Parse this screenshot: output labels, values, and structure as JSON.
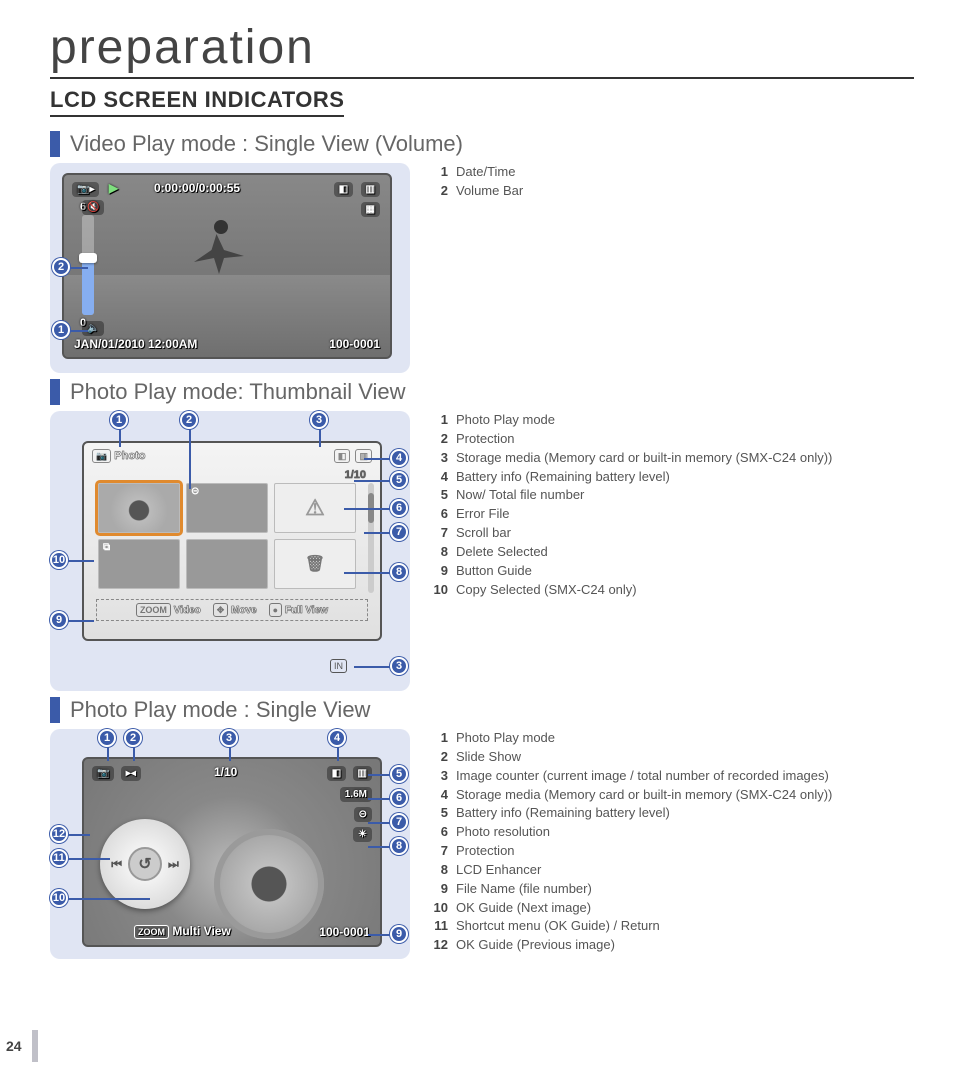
{
  "page_number": "24",
  "chapter": "preparation",
  "section": "LCD SCREEN INDICATORS",
  "subsections": {
    "s1": {
      "title": "Video Play mode : Single View (Volume)"
    },
    "s2": {
      "title": "Photo Play mode: Thumbnail View"
    },
    "s3": {
      "title": "Photo Play mode : Single View"
    }
  },
  "lcd1": {
    "time": "0:00:00/0:00:55",
    "vol_top": "6",
    "vol_bottom": "0",
    "date": "JAN/01/2010 12:00AM",
    "file_no": "100-0001"
  },
  "lcd2": {
    "mode_label": "Photo",
    "counter": "1/10",
    "guide_zoom": "Video",
    "guide_move": "Move",
    "guide_full": "Full View",
    "in_badge": "IN"
  },
  "lcd3": {
    "counter": "1/10",
    "res": "1.6M",
    "multi": "Multi View",
    "file_no": "100-0001"
  },
  "legend1": [
    {
      "n": "1",
      "t": "Date/Time"
    },
    {
      "n": "2",
      "t": "Volume Bar"
    }
  ],
  "legend2": [
    {
      "n": "1",
      "t": "Photo Play mode"
    },
    {
      "n": "2",
      "t": "Protection"
    },
    {
      "n": "3",
      "t": "Storage media (Memory card or built-in memory (SMX-C24 only))"
    },
    {
      "n": "4",
      "t": "Battery info (Remaining battery level)"
    },
    {
      "n": "5",
      "t": "Now/ Total file number"
    },
    {
      "n": "6",
      "t": "Error File"
    },
    {
      "n": "7",
      "t": "Scroll bar"
    },
    {
      "n": "8",
      "t": "Delete Selected"
    },
    {
      "n": "9",
      "t": "Button Guide"
    },
    {
      "n": "10",
      "t": "Copy Selected (SMX-C24 only)"
    }
  ],
  "legend3": [
    {
      "n": "1",
      "t": "Photo Play mode"
    },
    {
      "n": "2",
      "t": "Slide Show"
    },
    {
      "n": "3",
      "t": "Image counter (current image / total number of recorded images)"
    },
    {
      "n": "4",
      "t": "Storage media (Memory card or built-in memory (SMX-C24 only))"
    },
    {
      "n": "5",
      "t": "Battery info (Remaining battery level)"
    },
    {
      "n": "6",
      "t": "Photo resolution"
    },
    {
      "n": "7",
      "t": "Protection"
    },
    {
      "n": "8",
      "t": "LCD Enhancer"
    },
    {
      "n": "9",
      "t": "File Name (file number)"
    },
    {
      "n": "10",
      "t": "OK Guide (Next image)"
    },
    {
      "n": "11",
      "t": "Shortcut menu (OK Guide) / Return"
    },
    {
      "n": "12",
      "t": "OK Guide (Previous image)"
    }
  ],
  "callouts": {
    "p1": {
      "c1": "1",
      "c2": "2"
    },
    "p2": {
      "c1": "1",
      "c2": "2",
      "c3": "3",
      "c4": "4",
      "c5": "5",
      "c6": "6",
      "c7": "7",
      "c8": "8",
      "c9": "9",
      "c10": "10",
      "c3b": "3"
    },
    "p3": {
      "c1": "1",
      "c2": "2",
      "c3": "3",
      "c4": "4",
      "c5": "5",
      "c6": "6",
      "c7": "7",
      "c8": "8",
      "c9": "9",
      "c10": "10",
      "c11": "11",
      "c12": "12"
    }
  },
  "icons": {
    "play": "▶",
    "speaker_off": "🔇",
    "speaker": "🔈",
    "card": "◧",
    "battery": "▥",
    "lock": "⊝",
    "warn": "⚠",
    "trash": "🗑",
    "zoom": "ZOOM",
    "prev": "⏮",
    "next": "⏭",
    "return": "↺",
    "enh": "☀",
    "slideshow": "▸◂"
  }
}
